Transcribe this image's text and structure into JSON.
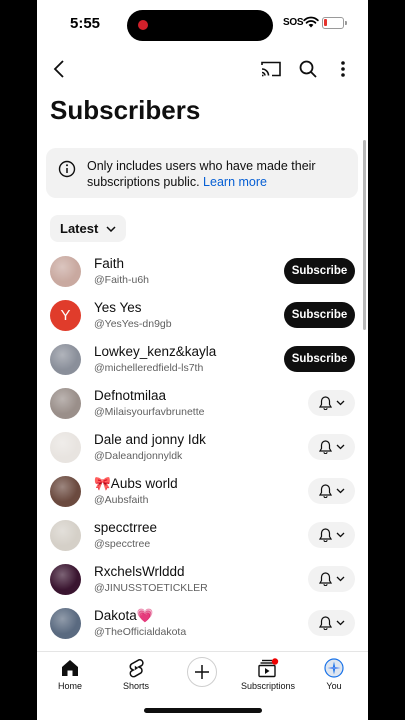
{
  "status": {
    "time": "5:55",
    "sos": "SOS",
    "battery_level": 0.15
  },
  "page": {
    "title": "Subscribers"
  },
  "info": {
    "text": "Only includes users who have made their subscriptions public.",
    "link": "Learn more"
  },
  "filter": {
    "label": "Latest"
  },
  "subscribers": [
    {
      "name": "Faith",
      "handle": "@Faith-u6h",
      "action": "subscribe",
      "button": "Subscribe",
      "avatar_color": "#c9a9a0"
    },
    {
      "name": "Yes Yes",
      "handle": "@YesYes-dn9gb",
      "action": "subscribe",
      "button": "Subscribe",
      "avatar_letter": "Y",
      "avatar_color": "#e03c2b"
    },
    {
      "name": "Lowkey_kenz&kayla",
      "handle": "@michelleredfield-ls7th",
      "action": "subscribe",
      "button": "Subscribe",
      "avatar_color": "#8a8f9a"
    },
    {
      "name": "Defnotmilaa",
      "handle": "@Milaisyourfavbrunette",
      "action": "bell",
      "avatar_color": "#9a8f8a"
    },
    {
      "name": "Dale and jonny Idk",
      "handle": "@Daleandjonnyldk",
      "action": "bell",
      "avatar_color": "#e8e4e0"
    },
    {
      "name": "🎀Aubs world",
      "handle": "@Aubsfaith",
      "action": "bell",
      "avatar_color": "#6b4a3f"
    },
    {
      "name": "specctrree",
      "handle": "@specctree",
      "action": "bell",
      "avatar_color": "#d5d0c8"
    },
    {
      "name": "RxchelsWrlddd",
      "handle": "@JINUSSTOETICKLER",
      "action": "bell",
      "avatar_color": "#3a1530"
    },
    {
      "name": "Dakota💗",
      "handle": "@TheOfficialdakota",
      "action": "bell",
      "avatar_color": "#5a6a80"
    }
  ],
  "nav": {
    "home": "Home",
    "shorts": "Shorts",
    "subscriptions": "Subscriptions",
    "you": "You"
  },
  "icons": [
    "back-icon",
    "cast-icon",
    "search-icon",
    "more-icon",
    "info-icon",
    "chevron-down-icon",
    "bell-icon",
    "home-icon",
    "shorts-icon",
    "plus-icon",
    "subscriptions-icon"
  ]
}
